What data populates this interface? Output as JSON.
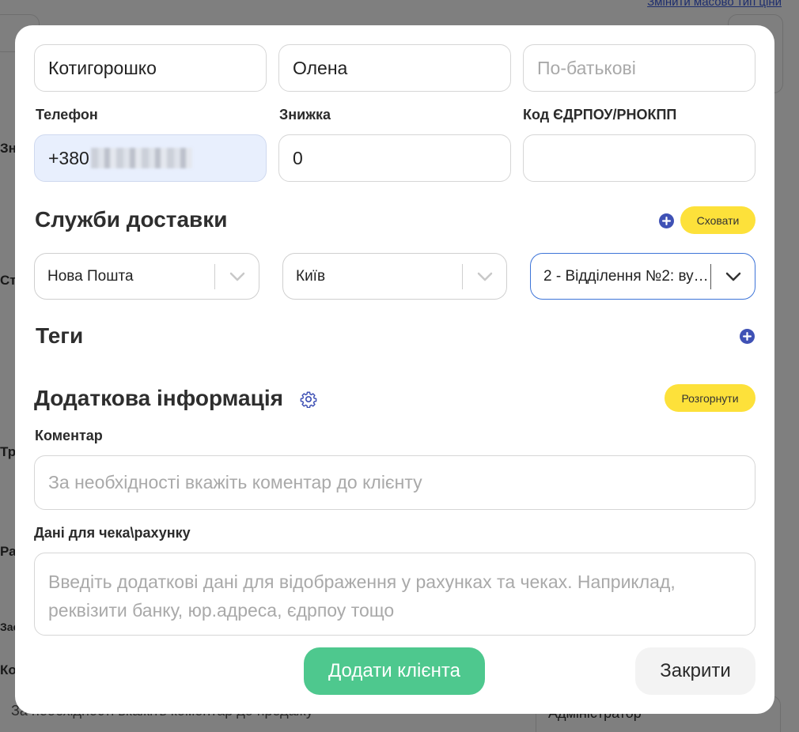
{
  "background": {
    "link": "Змінити масово тип ціни",
    "fragments": [
      "Зн",
      "Ст",
      "Тр",
      "Ра",
      "Зас",
      "Ко"
    ],
    "bottom_placeholder": "За необхідності вкажіть коментар до продажу",
    "bottom_right_value": "Адміністратор"
  },
  "modal": {
    "name_fields": {
      "last_name": "Котигорошко",
      "first_name": "Олена",
      "middle_name_placeholder": "По-батькові"
    },
    "labels": {
      "phone": "Телефон",
      "discount": "Знижка",
      "edrpou": "Код ЄДРПОУ/РНОКПП"
    },
    "phone_value": "+380",
    "discount_value": "0",
    "edrpou_value": "",
    "delivery": {
      "title": "Служби доставки",
      "hide_label": "Сховати",
      "service": "Нова Пошта",
      "city": "Київ",
      "branch": "2 - Відділення №2: ву…"
    },
    "tags": {
      "title": "Теги"
    },
    "additional": {
      "title": "Додаткова інформація",
      "expand_label": "Розгорнути",
      "comment_label": "Коментар",
      "comment_placeholder": "За необхідності вкажіть коментар до клієнту",
      "receipt_label": "Дані для чека\\рахунку",
      "receipt_placeholder": "Введіть додаткові дані для відображення у рахунках та чеках. Наприклад, реквізити банку, юр.адреса, єдрпоу тощо"
    },
    "buttons": {
      "add": "Додати клієнта",
      "close": "Закрити"
    },
    "colors": {
      "accent_yellow": "#fde13a",
      "primary_green": "#4ec88e",
      "plus_blue": "#3f51b5",
      "phone_bg": "#e8effd"
    }
  }
}
